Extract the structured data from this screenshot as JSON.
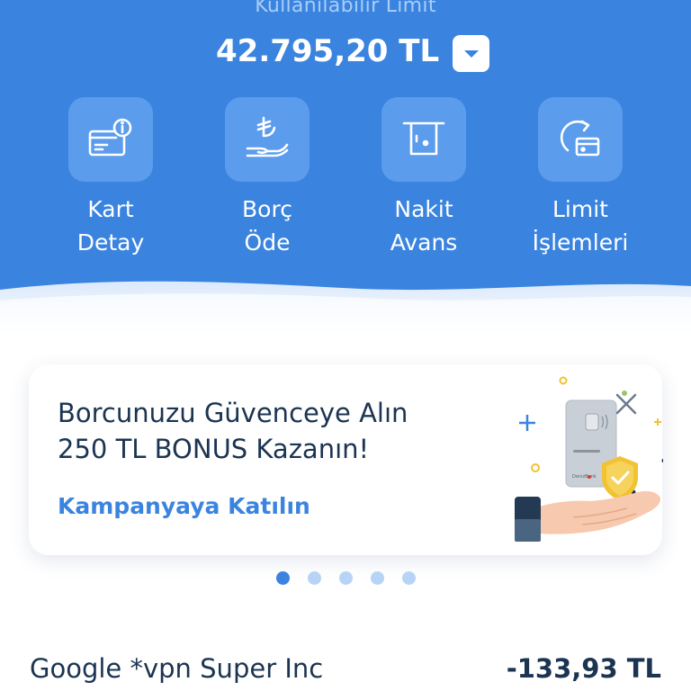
{
  "header": {
    "limit_label": "Kullanılabilir Limit",
    "limit_amount": "42.795,20 TL",
    "toggle_icon": "chevron-down-icon"
  },
  "actions": [
    {
      "line1": "Kart",
      "line2": "Detay",
      "icon": "card-info-icon"
    },
    {
      "line1": "Borç",
      "line2": "Öde",
      "icon": "lira-hand-icon"
    },
    {
      "line1": "Nakit",
      "line2": "Avans",
      "icon": "atm-cash-icon"
    },
    {
      "line1": "Limit",
      "line2": "İşlemleri",
      "icon": "limit-refresh-icon"
    }
  ],
  "promo": {
    "title_line1": "Borcunuzu Güvenceye Alın",
    "title_line2": "250 TL BONUS Kazanın!",
    "link": "Kampanyaya Katılın",
    "card_brand": "DenizBank",
    "slides": 5,
    "active_slide": 1
  },
  "transactions": [
    {
      "merchant": "Google *vpn Super Inc",
      "amount": "-133,93 TL"
    }
  ],
  "colors": {
    "brand_blue": "#3a84e0",
    "tile_blue": "#5b9cec",
    "text_dark": "#1b3452",
    "shield_gold": "#f2c230"
  }
}
